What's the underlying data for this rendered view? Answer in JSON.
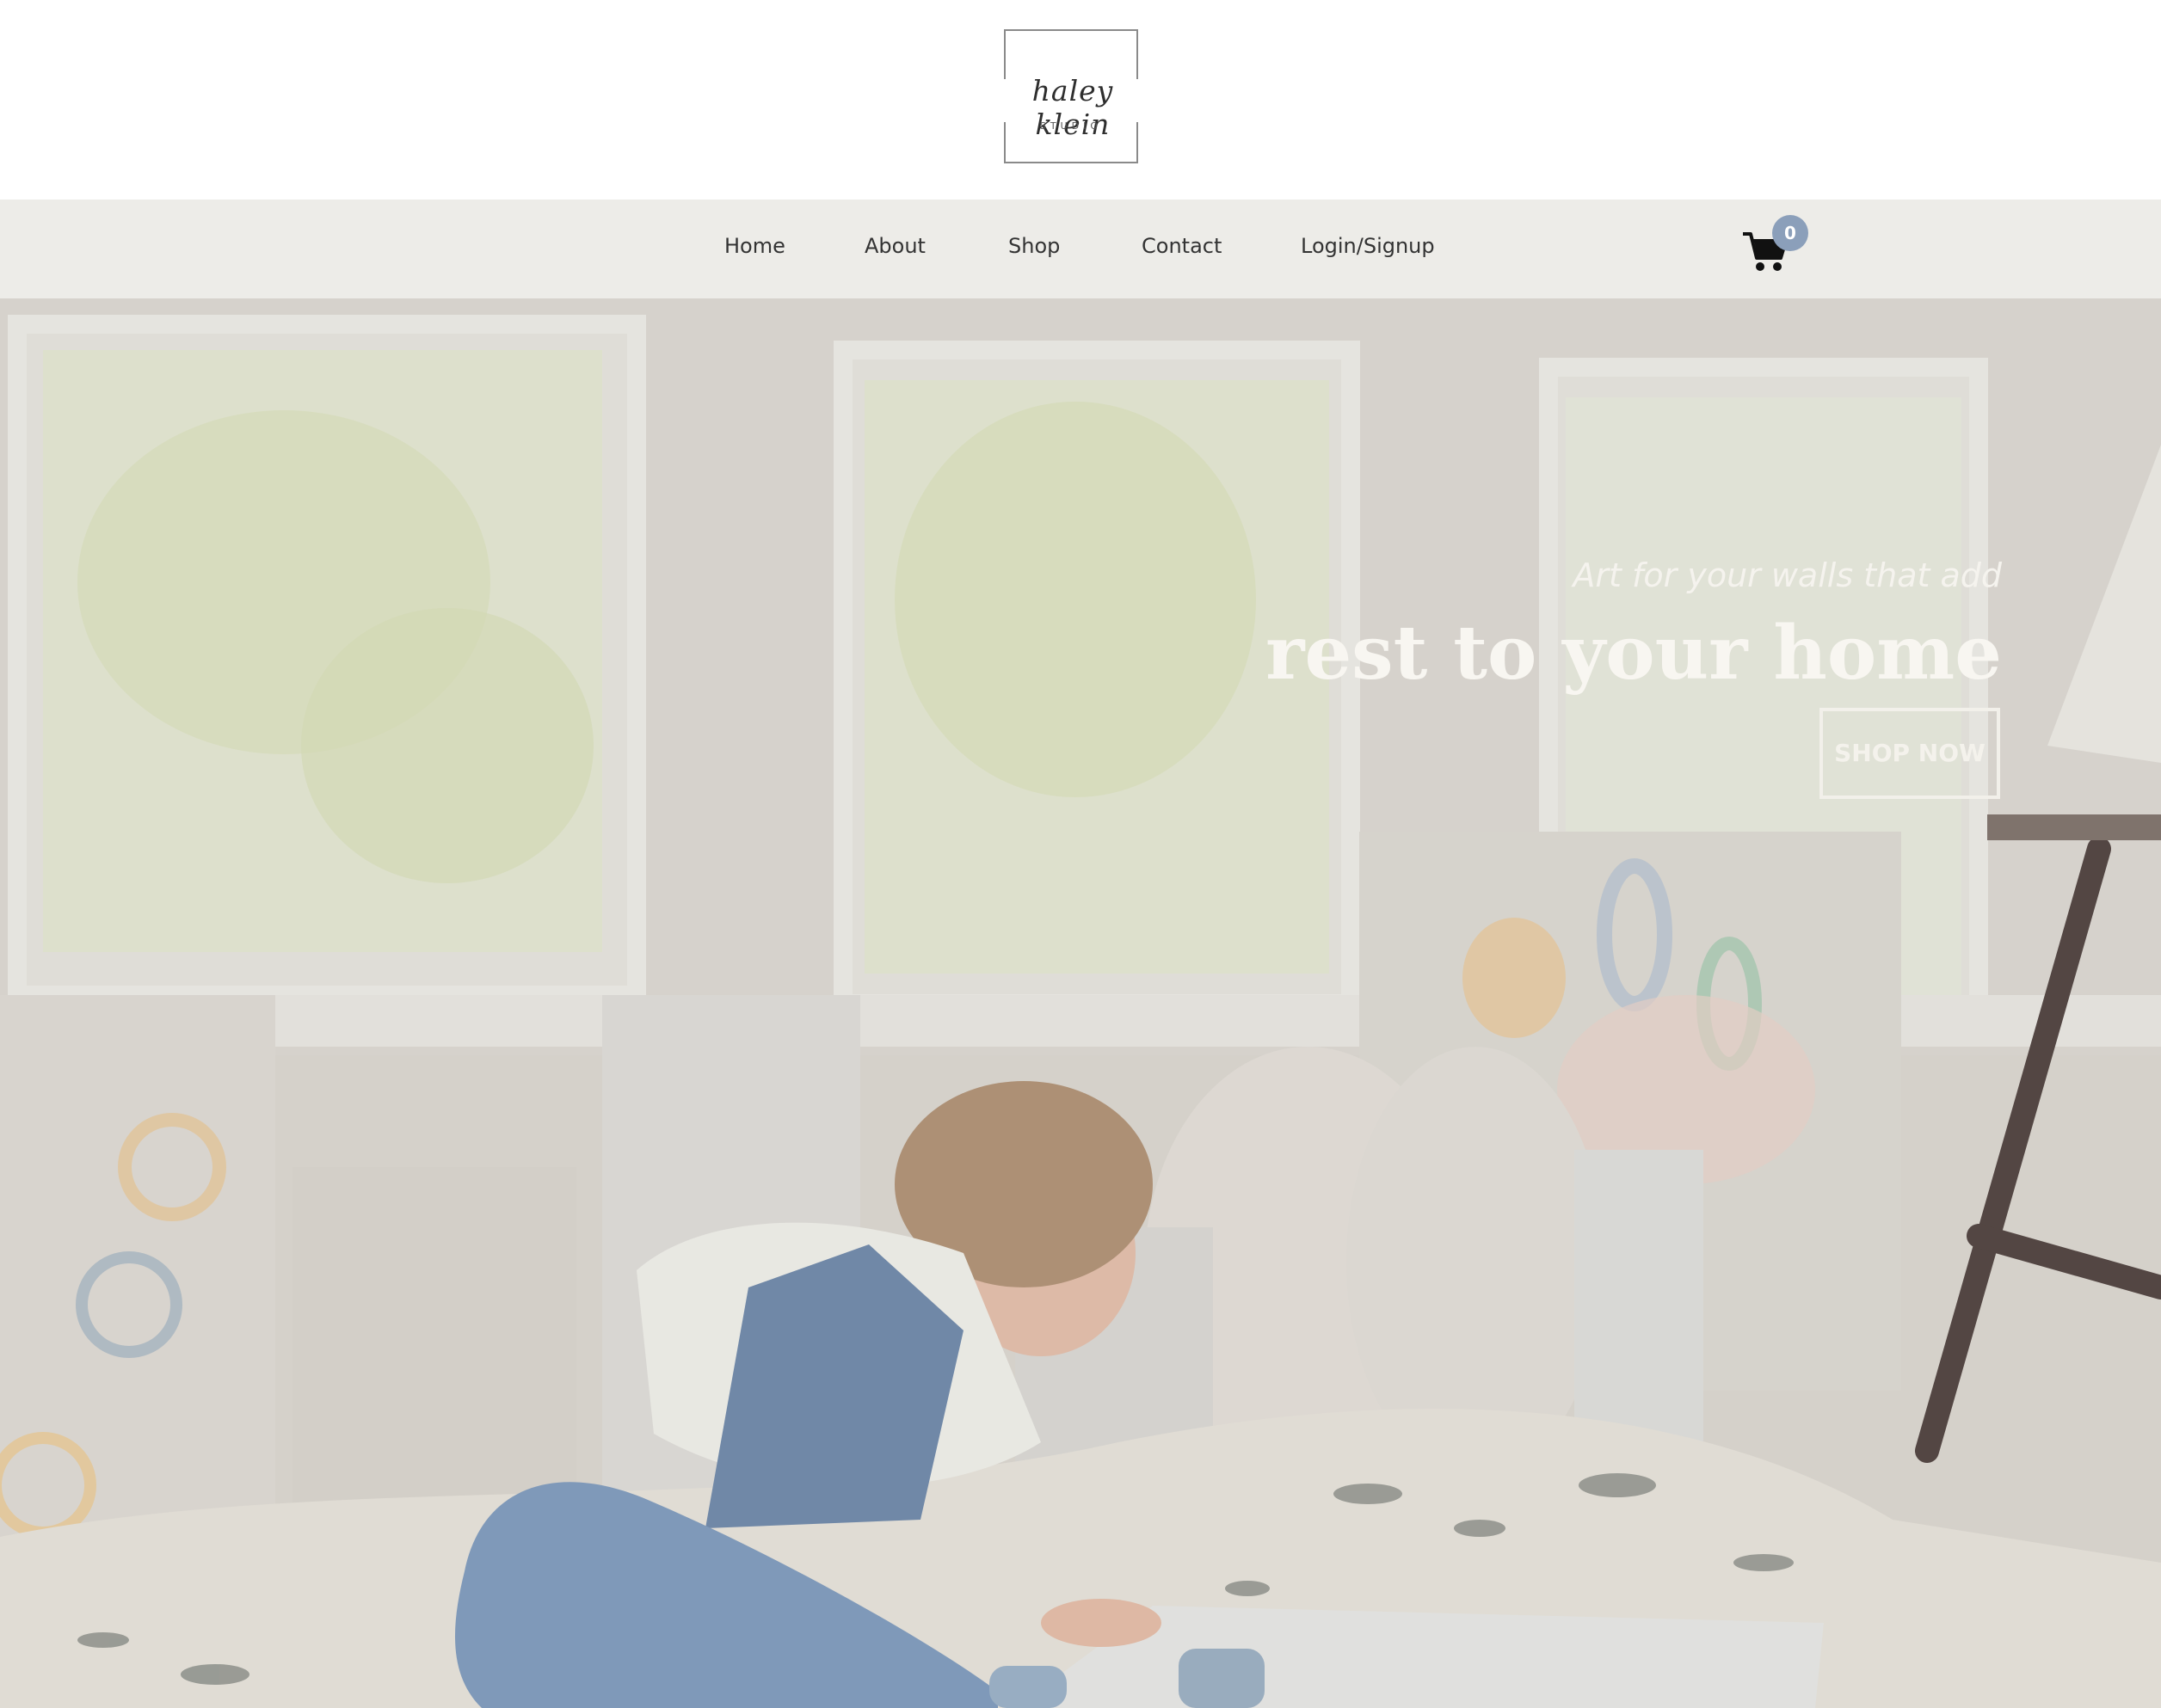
{
  "brand": {
    "logo_script": "haley klein",
    "logo_subtext": "STUDIO"
  },
  "nav": {
    "items": [
      {
        "label": "Home"
      },
      {
        "label": "About"
      },
      {
        "label": "Shop"
      },
      {
        "label": "Contact"
      },
      {
        "label": "Login/Signup"
      }
    ],
    "cart": {
      "icon": "shopping-cart-icon",
      "count": "0"
    }
  },
  "hero": {
    "tagline": "Art for your walls that add",
    "headline": "rest to your home",
    "cta_label": "SHOP NOW"
  },
  "colors": {
    "nav_background": "#edece8",
    "cart_badge": "#8b9fba",
    "hero_text": "#f8f6f1"
  }
}
